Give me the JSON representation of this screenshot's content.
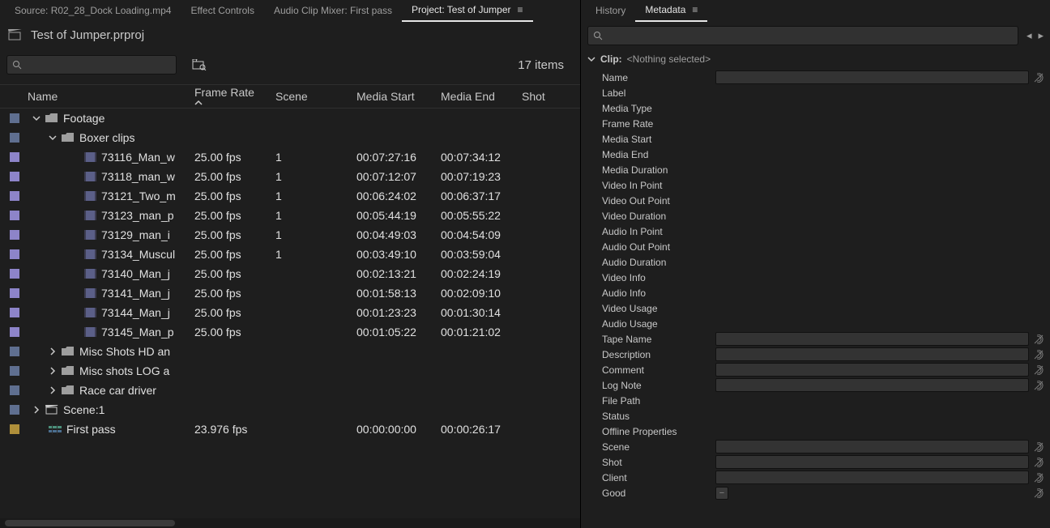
{
  "left_tabs": [
    {
      "label": "Source: R02_28_Dock Loading.mp4",
      "active": false,
      "menu": false
    },
    {
      "label": "Effect Controls",
      "active": false,
      "menu": false
    },
    {
      "label": "Audio Clip Mixer: First pass",
      "active": false,
      "menu": false
    },
    {
      "label": "Project: Test of Jumper",
      "active": true,
      "menu": true
    }
  ],
  "right_tabs": [
    {
      "label": "History",
      "active": false,
      "menu": false
    },
    {
      "label": "Metadata",
      "active": true,
      "menu": true
    }
  ],
  "project_name": "Test of Jumper.prproj",
  "item_count_text": "17 items",
  "columns": {
    "name": "Name",
    "frame_rate": "Frame Rate",
    "scene": "Scene",
    "media_start": "Media Start",
    "media_end": "Media End",
    "shot": "Shot"
  },
  "rows": [
    {
      "type": "folder",
      "indent": 0,
      "twisty": "v",
      "label_color": "blue",
      "name": "Footage"
    },
    {
      "type": "folder",
      "indent": 1,
      "twisty": "v",
      "label_color": "blue",
      "name": "Boxer clips"
    },
    {
      "type": "clip",
      "indent": 3,
      "label_color": "violet",
      "name": "73116_Man_w",
      "fps": "25.00 fps",
      "scene": "1",
      "mstart": "00:07:27:16",
      "mend": "00:07:34:12"
    },
    {
      "type": "clip",
      "indent": 3,
      "label_color": "violet",
      "name": "73118_man_w",
      "fps": "25.00 fps",
      "scene": "1",
      "mstart": "00:07:12:07",
      "mend": "00:07:19:23"
    },
    {
      "type": "clip",
      "indent": 3,
      "label_color": "violet",
      "name": "73121_Two_m",
      "fps": "25.00 fps",
      "scene": "1",
      "mstart": "00:06:24:02",
      "mend": "00:06:37:17"
    },
    {
      "type": "clip",
      "indent": 3,
      "label_color": "violet",
      "name": "73123_man_p",
      "fps": "25.00 fps",
      "scene": "1",
      "mstart": "00:05:44:19",
      "mend": "00:05:55:22"
    },
    {
      "type": "clip",
      "indent": 3,
      "label_color": "violet",
      "name": "73129_man_i",
      "fps": "25.00 fps",
      "scene": "1",
      "mstart": "00:04:49:03",
      "mend": "00:04:54:09"
    },
    {
      "type": "clip",
      "indent": 3,
      "label_color": "violet",
      "name": "73134_Muscul",
      "fps": "25.00 fps",
      "scene": "1",
      "mstart": "00:03:49:10",
      "mend": "00:03:59:04"
    },
    {
      "type": "clip",
      "indent": 3,
      "label_color": "violet",
      "name": "73140_Man_j",
      "fps": "25.00 fps",
      "scene": "",
      "mstart": "00:02:13:21",
      "mend": "00:02:24:19"
    },
    {
      "type": "clip",
      "indent": 3,
      "label_color": "violet",
      "name": "73141_Man_j",
      "fps": "25.00 fps",
      "scene": "",
      "mstart": "00:01:58:13",
      "mend": "00:02:09:10"
    },
    {
      "type": "clip",
      "indent": 3,
      "label_color": "violet",
      "name": "73144_Man_j",
      "fps": "25.00 fps",
      "scene": "",
      "mstart": "00:01:23:23",
      "mend": "00:01:30:14"
    },
    {
      "type": "clip",
      "indent": 3,
      "label_color": "violet",
      "name": "73145_Man_p",
      "fps": "25.00 fps",
      "scene": "",
      "mstart": "00:01:05:22",
      "mend": "00:01:21:02"
    },
    {
      "type": "folder",
      "indent": 1,
      "twisty": ">",
      "label_color": "blue",
      "name": "Misc Shots HD an"
    },
    {
      "type": "folder",
      "indent": 1,
      "twisty": ">",
      "label_color": "blue",
      "name": "Misc shots LOG a"
    },
    {
      "type": "folder",
      "indent": 1,
      "twisty": ">",
      "label_color": "blue",
      "name": "Race car driver"
    },
    {
      "type": "scene",
      "indent": 0,
      "twisty": ">",
      "label_color": "blue",
      "name": "Scene:1"
    },
    {
      "type": "sequence",
      "indent": 1,
      "label_color": "ochre",
      "name": "First pass",
      "fps": "23.976 fps",
      "scene": "",
      "mstart": "00:00:00:00",
      "mend": "00:00:26:17"
    }
  ],
  "clip_header": {
    "label": "Clip:",
    "selection": "<Nothing selected>"
  },
  "meta_fields": [
    {
      "key": "Name",
      "input": true,
      "speech": true
    },
    {
      "key": "Label",
      "input": false,
      "speech": false
    },
    {
      "key": "Media Type",
      "input": false,
      "speech": false
    },
    {
      "key": "Frame Rate",
      "input": false,
      "speech": false
    },
    {
      "key": "Media Start",
      "input": false,
      "speech": false
    },
    {
      "key": "Media End",
      "input": false,
      "speech": false
    },
    {
      "key": "Media Duration",
      "input": false,
      "speech": false
    },
    {
      "key": "Video In Point",
      "input": false,
      "speech": false
    },
    {
      "key": "Video Out Point",
      "input": false,
      "speech": false
    },
    {
      "key": "Video Duration",
      "input": false,
      "speech": false
    },
    {
      "key": "Audio In Point",
      "input": false,
      "speech": false
    },
    {
      "key": "Audio Out Point",
      "input": false,
      "speech": false
    },
    {
      "key": "Audio Duration",
      "input": false,
      "speech": false
    },
    {
      "key": "Video Info",
      "input": false,
      "speech": false
    },
    {
      "key": "Audio Info",
      "input": false,
      "speech": false
    },
    {
      "key": "Video Usage",
      "input": false,
      "speech": false
    },
    {
      "key": "Audio Usage",
      "input": false,
      "speech": false
    },
    {
      "key": "Tape Name",
      "input": true,
      "speech": true
    },
    {
      "key": "Description",
      "input": true,
      "speech": true
    },
    {
      "key": "Comment",
      "input": true,
      "speech": true
    },
    {
      "key": "Log Note",
      "input": true,
      "speech": true
    },
    {
      "key": "File Path",
      "input": false,
      "speech": false
    },
    {
      "key": "Status",
      "input": false,
      "speech": false
    },
    {
      "key": "Offline Properties",
      "input": false,
      "speech": false
    },
    {
      "key": "Scene",
      "input": true,
      "speech": true
    },
    {
      "key": "Shot",
      "input": true,
      "speech": true
    },
    {
      "key": "Client",
      "input": true,
      "speech": true
    },
    {
      "key": "Good",
      "checkbox": true,
      "speech": true
    }
  ]
}
